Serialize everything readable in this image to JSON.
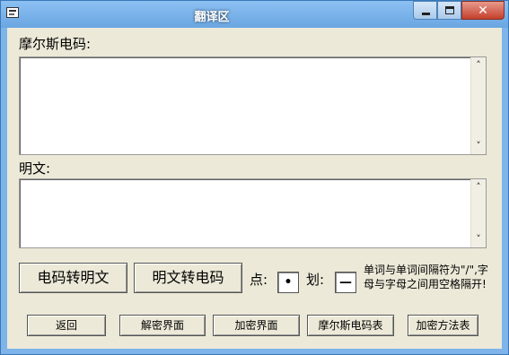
{
  "window": {
    "title": "翻译区"
  },
  "titlebar": {
    "close_glyph": "✕",
    "app_icon": "window-icon",
    "min_icon": "minimize-icon",
    "max_icon": "maximize-icon",
    "close_icon": "close-icon"
  },
  "morse_label": "摩尔斯电码:",
  "plain_label": "明文:",
  "morse_text": {
    "value": ""
  },
  "plain_text": {
    "value": ""
  },
  "scroll": {
    "up": "˄",
    "down": "˅"
  },
  "convert": {
    "to_plain_label": "电码转明文",
    "to_morse_label": "明文转电码"
  },
  "dot": {
    "label": "点:",
    "value": "•"
  },
  "dash": {
    "label": "划:",
    "value": "—"
  },
  "note": "单词与单词间隔符为\"/\",字母与字母之间用空格隔开!",
  "bottom_buttons": {
    "back": "返回",
    "decrypt": "解密界面",
    "encrypt": "加密界面",
    "morse_table": "摩尔斯电码表",
    "cipher_table": "加密方法表"
  }
}
